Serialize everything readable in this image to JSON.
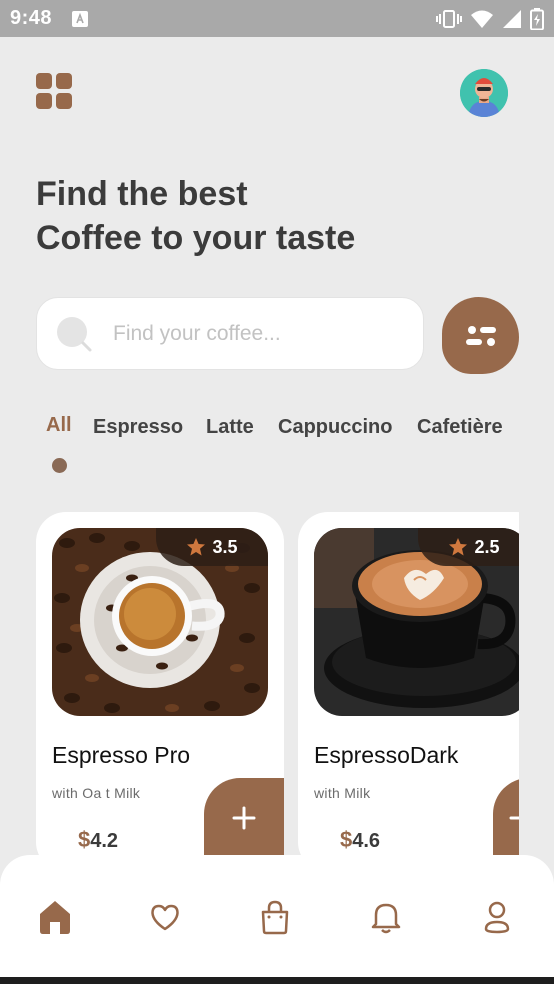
{
  "status_bar": {
    "time": "9:48"
  },
  "header": {
    "headline_line1": "Find the best",
    "headline_line2": "Coffee to your taste"
  },
  "search": {
    "placeholder": "Find your coffee..."
  },
  "categories": [
    "All",
    "Espresso",
    "Latte",
    "Cappuccino",
    "Cafetière"
  ],
  "selected_category": "All",
  "products": [
    {
      "name": "Espresso Pro",
      "subtitle": "with Oa t Milk",
      "currency": "$",
      "price": "4.2",
      "rating": "3.5"
    },
    {
      "name": "EspressoDark",
      "subtitle": "with Milk",
      "currency": "$",
      "price": "4.6",
      "rating": "2.5"
    }
  ],
  "nav": [
    "home-icon",
    "heart-icon",
    "bag-icon",
    "bell-icon",
    "profile-icon"
  ],
  "colors": {
    "accent": "#97694b",
    "background": "#ebebeb",
    "text": "#3b3b3b"
  }
}
